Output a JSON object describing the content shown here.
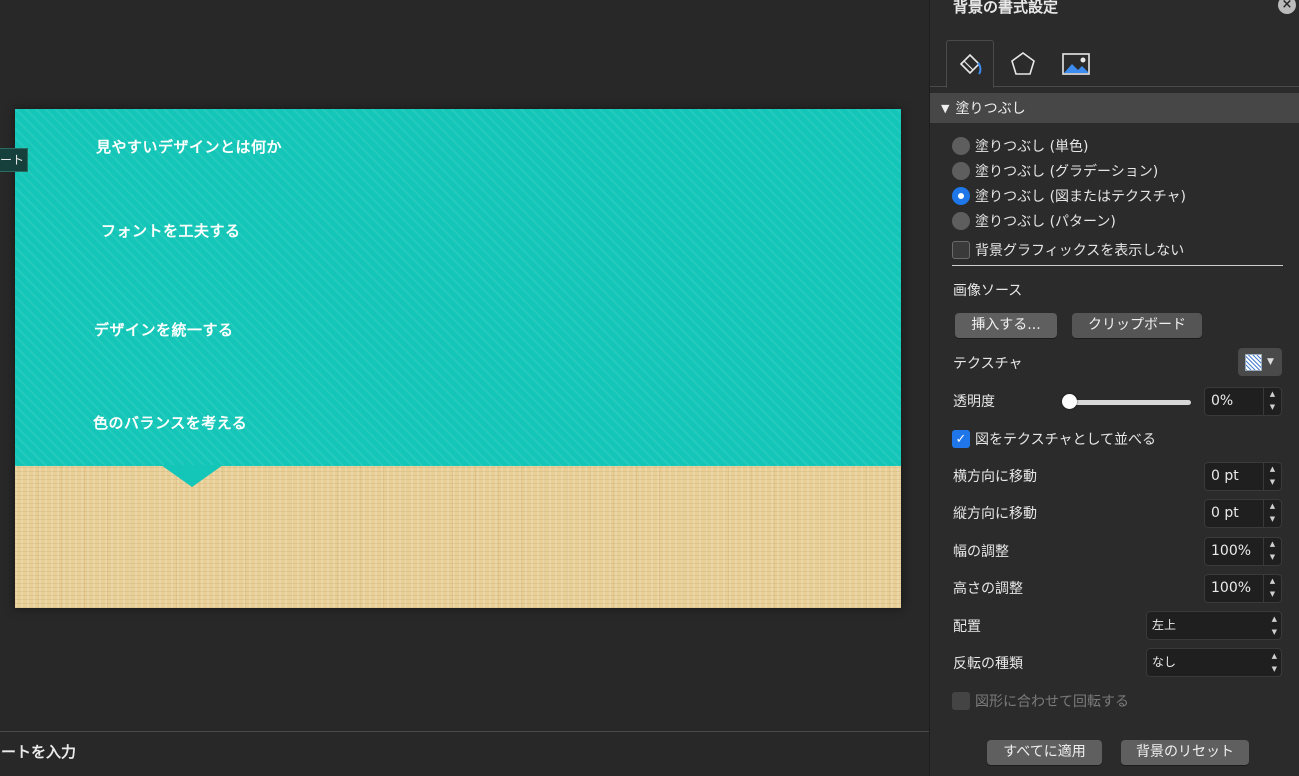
{
  "slide": {
    "texts": [
      "見やすいデザインとは何か",
      "フォントを工夫する",
      "デザインを統一する",
      "色のバランスを考える"
    ],
    "tooltip": "ート",
    "notes_placeholder": "ノートを入力"
  },
  "panel": {
    "title": "背景の書式設定",
    "tabs": [
      "fill-icon",
      "shape-effects-icon",
      "picture-icon"
    ],
    "section": "塗りつぶし",
    "fill_options": [
      {
        "label": "塗りつぶし (単色)",
        "selected": false
      },
      {
        "label": "塗りつぶし (グラデーション)",
        "selected": false
      },
      {
        "label": "塗りつぶし (図またはテクスチャ)",
        "selected": true
      },
      {
        "label": "塗りつぶし (パターン)",
        "selected": false
      }
    ],
    "hide_background_graphics": "背景グラフィックスを表示しない",
    "image_source_label": "画像ソース",
    "insert_button": "挿入する...",
    "clipboard_button": "クリップボード",
    "texture_label": "テクスチャ",
    "transparency_label": "透明度",
    "transparency_value": "0%",
    "transparency_level": 0,
    "tile_checkbox": "図をテクスチャとして並べる",
    "offset_x_label": "横方向に移動",
    "offset_x_value": "0 pt",
    "offset_y_label": "縦方向に移動",
    "offset_y_value": "0 pt",
    "scale_x_label": "幅の調整",
    "scale_x_value": "100%",
    "scale_y_label": "高さの調整",
    "scale_y_value": "100%",
    "alignment_label": "配置",
    "alignment_value": "左上",
    "mirror_label": "反転の種類",
    "mirror_value": "なし",
    "rotate_with_shape": "図形に合わせて回転する",
    "apply_all_button": "すべてに適用",
    "reset_button": "背景のリセット"
  }
}
